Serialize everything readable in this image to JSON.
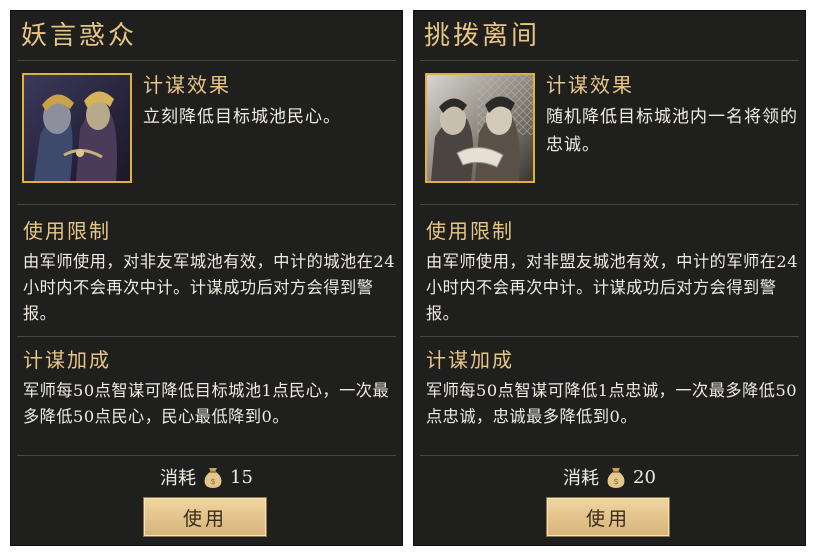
{
  "panels": [
    {
      "title": "妖言惑众",
      "effect_heading": "计谋效果",
      "effect_text": "立刻降低目标城池民心。",
      "limit_heading": "使用限制",
      "limit_text": "由军师使用，对非友军城池有效，中计的城池在24小时内不会再次中计。计谋成功后对方会得到警报。",
      "bonus_heading": "计谋加成",
      "bonus_text": "军师每50点智谋可降低目标城池1点民心，一次最多降低50点民心，民心最低降到0。",
      "cost_label": "消耗",
      "cost_value": "15",
      "cost_icon": "money-pouch-icon",
      "button_label": "使用"
    },
    {
      "title": "挑拨离间",
      "effect_heading": "计谋效果",
      "effect_text": "随机降低目标城池内一名将领的忠诚。",
      "limit_heading": "使用限制",
      "limit_text": "由军师使用，对非盟友城池有效，中计的军师在24小时内不会再次中计。计谋成功后对方会得到警报。",
      "bonus_heading": "计谋加成",
      "bonus_text": "军师每50点智谋可降低1点忠诚，一次最多降低50点忠诚，忠诚最多降低到0。",
      "cost_label": "消耗",
      "cost_value": "20",
      "cost_icon": "money-pouch-icon",
      "button_label": "使用"
    }
  ],
  "colors": {
    "panel_bg": "#1f1f1e",
    "heading": "#e7c585",
    "text": "#f0ebe1",
    "portrait_border": "#e0b23a",
    "button_bg": "#e4c48c"
  }
}
